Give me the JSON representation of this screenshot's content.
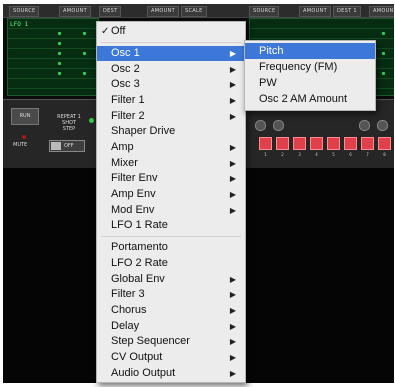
{
  "header": {
    "labels": [
      "SOURCE",
      "AMOUNT",
      "DEST",
      "AMOUNT",
      "SCALE",
      "SOURCE",
      "AMOUNT",
      "DEST 1",
      "AMOUNT"
    ]
  },
  "lane": {
    "source_label": "LFO 1"
  },
  "panel": {
    "run_label": "RUN",
    "repeat_label": "REPEAT 1 SHOT STEP",
    "mute_label": "MUTE",
    "toggle_label": "OFF",
    "step_numbers": [
      "1",
      "2",
      "3",
      "4",
      "5",
      "6",
      "7",
      "8"
    ]
  },
  "menu": {
    "items": [
      {
        "label": "Off",
        "checked": true,
        "submenu": false
      },
      {
        "label": "Osc 1",
        "submenu": true,
        "highlighted": true
      },
      {
        "label": "Osc 2",
        "submenu": true
      },
      {
        "label": "Osc 3",
        "submenu": true
      },
      {
        "label": "Filter 1",
        "submenu": true
      },
      {
        "label": "Filter 2",
        "submenu": true
      },
      {
        "label": "Shaper Drive",
        "submenu": false
      },
      {
        "label": "Amp",
        "submenu": true
      },
      {
        "label": "Mixer",
        "submenu": true
      },
      {
        "label": "Filter Env",
        "submenu": true
      },
      {
        "label": "Amp Env",
        "submenu": true
      },
      {
        "label": "Mod Env",
        "submenu": true
      },
      {
        "label": "LFO 1 Rate",
        "submenu": false
      },
      {
        "label": "Portamento",
        "submenu": false
      },
      {
        "label": "LFO 2 Rate",
        "submenu": false
      },
      {
        "label": "Global Env",
        "submenu": true
      },
      {
        "label": "Filter 3",
        "submenu": true
      },
      {
        "label": "Chorus",
        "submenu": true
      },
      {
        "label": "Delay",
        "submenu": true
      },
      {
        "label": "Step Sequencer",
        "submenu": true
      },
      {
        "label": "CV Output",
        "submenu": true
      },
      {
        "label": "Audio Output",
        "submenu": true
      }
    ],
    "check_glyph": "✓",
    "arrow_glyph": "▶"
  },
  "submenu": {
    "items": [
      {
        "label": "Pitch",
        "highlighted": true
      },
      {
        "label": "Frequency (FM)"
      },
      {
        "label": "PW"
      },
      {
        "label": "Osc 2 AM Amount"
      }
    ]
  },
  "colors": {
    "highlight": "#3d78d8",
    "menu_bg": "#ececec",
    "lane_green": "#062c12",
    "step_red": "#e0404c"
  }
}
